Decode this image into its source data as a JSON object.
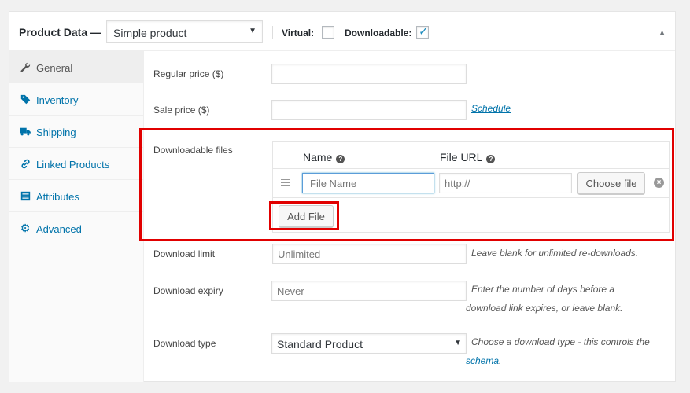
{
  "header": {
    "title": "Product Data —",
    "product_type": "Simple product",
    "virtual_label": "Virtual:",
    "virtual_checked": false,
    "downloadable_label": "Downloadable:",
    "downloadable_checked": true
  },
  "sidebar": {
    "items": [
      {
        "label": "General",
        "icon": "wrench-icon",
        "active": true
      },
      {
        "label": "Inventory",
        "icon": "tag-icon",
        "active": false
      },
      {
        "label": "Shipping",
        "icon": "truck-icon",
        "active": false
      },
      {
        "label": "Linked Products",
        "icon": "link-icon",
        "active": false
      },
      {
        "label": "Attributes",
        "icon": "list-icon",
        "active": false
      },
      {
        "label": "Advanced",
        "icon": "gear-icon",
        "active": false
      }
    ]
  },
  "general": {
    "regular_price_label": "Regular price ($)",
    "regular_price_value": "",
    "sale_price_label": "Sale price ($)",
    "sale_price_value": "",
    "schedule_link": "Schedule"
  },
  "downloads": {
    "label": "Downloadable files",
    "col_name": "Name",
    "col_url": "File URL",
    "rows": [
      {
        "name_placeholder": "File Name",
        "url_placeholder": "http://"
      }
    ],
    "choose_file": "Choose file",
    "add_file": "Add File"
  },
  "download_limit": {
    "label": "Download limit",
    "placeholder": "Unlimited",
    "hint": "Leave blank for unlimited re-downloads."
  },
  "download_expiry": {
    "label": "Download expiry",
    "placeholder": "Never",
    "hint_line1": "Enter the number of days before a",
    "hint_line2": "download link expires, or leave blank."
  },
  "download_type": {
    "label": "Download type",
    "value": "Standard Product",
    "hint_line1": "Choose a download type - this controls the",
    "hint_link": "schema",
    "hint_end": "."
  },
  "colors": {
    "link": "#0073aa",
    "highlight": "#e10000"
  }
}
